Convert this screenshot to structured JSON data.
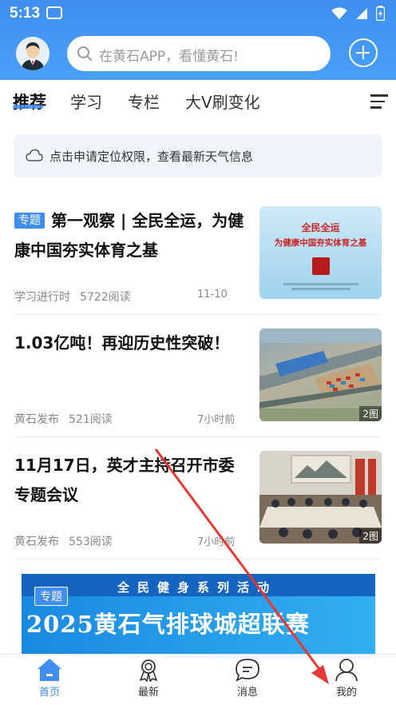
{
  "status_bar": {
    "time": "5:13"
  },
  "header": {
    "search_placeholder": "在黄石APP，看懂黄石!"
  },
  "tabs": [
    {
      "label": "推荐",
      "active": true
    },
    {
      "label": "学习",
      "active": false
    },
    {
      "label": "专栏",
      "active": false
    },
    {
      "label": "大V刷变化",
      "active": false
    }
  ],
  "weather": {
    "text": "点击申请定位权限，查看最新天气信息"
  },
  "news": [
    {
      "tag": "专题",
      "title": "第一观察 | 全民全运，为健康中国夯实体育之基",
      "source": "学习进行时",
      "reads": "5722阅读",
      "time": "11-10",
      "thumb_line1": "全民全运",
      "thumb_line2": "为健康中国夯实体育之基",
      "image_count": ""
    },
    {
      "tag": "",
      "title": "1.03亿吨！再迎历史性突破！",
      "source": "黄石发布",
      "reads": "521阅读",
      "time": "7小时前",
      "image_count": "2图"
    },
    {
      "tag": "",
      "title": "11月17日，英才主持召开市委专题会议",
      "source": "黄石发布",
      "reads": "553阅读",
      "time": "7小时前",
      "image_count": "2图"
    }
  ],
  "ad_banner": {
    "tag": "专题",
    "subtitle": "全民健身系列活动",
    "title": "2025黄石气排球城超联赛"
  },
  "bottom_nav": [
    {
      "label": "首页",
      "icon": "home-icon",
      "active": true
    },
    {
      "label": "最新",
      "icon": "latest-icon",
      "active": false
    },
    {
      "label": "消息",
      "icon": "message-icon",
      "active": false
    },
    {
      "label": "我的",
      "icon": "profile-icon",
      "active": false
    }
  ],
  "colors": {
    "brand": "#3f8ef0",
    "annotation": "#e53935"
  }
}
